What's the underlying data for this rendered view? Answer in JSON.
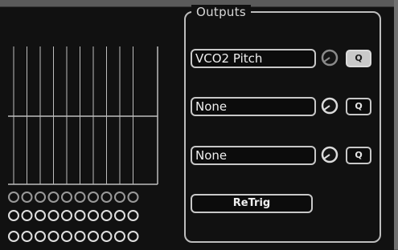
{
  "outputs": {
    "title": "Outputs",
    "rows": [
      {
        "select_value": "VCO2 Pitch",
        "q_label": "Q",
        "q_active": true
      },
      {
        "select_value": "None",
        "q_label": "Q",
        "q_active": false
      },
      {
        "select_value": "None",
        "q_label": "Q",
        "q_active": false
      }
    ],
    "retrig_label": "ReTrig"
  },
  "icons": {
    "knob": "knob-icon",
    "jack": "jack-icon"
  },
  "colors": {
    "background": "#111111",
    "outline": "#c8c8c8",
    "text": "#efefef",
    "active_q": "#c9c9c9"
  }
}
